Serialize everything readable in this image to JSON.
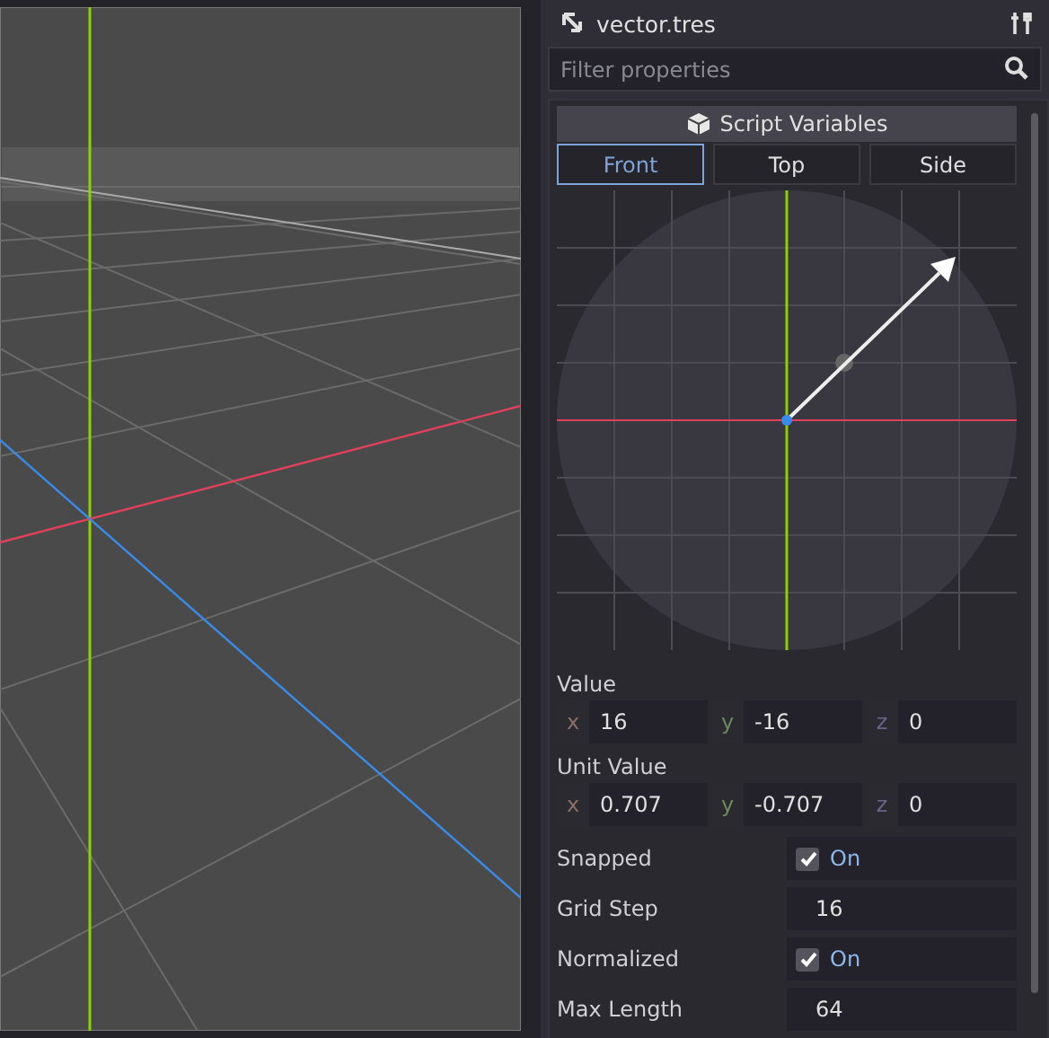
{
  "inspector": {
    "title": "vector.tres"
  },
  "filter": {
    "placeholder": "Filter properties"
  },
  "section": {
    "title": "Script Variables"
  },
  "view_tabs": [
    {
      "label": "Front",
      "selected": true
    },
    {
      "label": "Top",
      "selected": false
    },
    {
      "label": "Side",
      "selected": false
    }
  ],
  "properties": [
    {
      "kind": "vector",
      "label": "Value",
      "components": [
        {
          "axis": "x",
          "value": "16"
        },
        {
          "axis": "y",
          "value": "-16"
        },
        {
          "axis": "z",
          "value": "0"
        }
      ]
    },
    {
      "kind": "vector",
      "label": "Unit Value",
      "components": [
        {
          "axis": "x",
          "value": "0.707"
        },
        {
          "axis": "y",
          "value": "-0.707"
        },
        {
          "axis": "z",
          "value": "0"
        }
      ]
    },
    {
      "kind": "toggle",
      "label": "Snapped",
      "checked": true,
      "value": "On"
    },
    {
      "kind": "number",
      "label": "Grid Step",
      "value": "16"
    },
    {
      "kind": "toggle",
      "label": "Normalized",
      "checked": true,
      "value": "On"
    },
    {
      "kind": "number",
      "label": "Max Length",
      "value": "64"
    }
  ]
}
